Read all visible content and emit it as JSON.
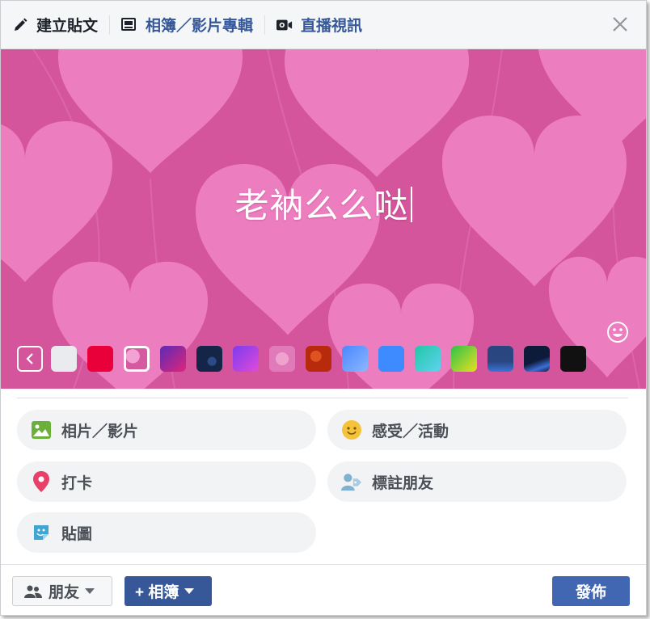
{
  "tabs": [
    {
      "label": "建立貼文",
      "icon": "pencil-icon",
      "active": true
    },
    {
      "label": "相簿／影片專輯",
      "icon": "album-icon",
      "active": false
    },
    {
      "label": "直播視訊",
      "icon": "video-camera-icon",
      "active": false
    }
  ],
  "composer": {
    "text": "老衲么么哒",
    "background": "pink-hearts",
    "swatches": [
      {
        "name": "white",
        "color": "#e9ebee"
      },
      {
        "name": "red",
        "color": "#e9003a"
      },
      {
        "name": "pink-hearts",
        "color": "#e37fbd",
        "selected": true
      },
      {
        "name": "purple-magenta-gradient",
        "color": "#9c2bb0"
      },
      {
        "name": "dark-navy-pattern",
        "color": "#1c2f5a"
      },
      {
        "name": "purple-violet-gradient",
        "color": "#c43ef0"
      },
      {
        "name": "light-pink-pattern",
        "color": "#e68cc4"
      },
      {
        "name": "red-orange-pattern",
        "color": "#c5300f"
      },
      {
        "name": "blue-sky",
        "color": "#5b9bff"
      },
      {
        "name": "blue",
        "color": "#3d8bff"
      },
      {
        "name": "teal-gradient",
        "color": "#3ccfc0"
      },
      {
        "name": "green-yellow-gradient",
        "color": "#7ad61a"
      },
      {
        "name": "dark-blue-pattern",
        "color": "#22396a"
      },
      {
        "name": "night-sky",
        "color": "#17234a"
      },
      {
        "name": "black",
        "color": "#111111"
      }
    ]
  },
  "actions": [
    {
      "label": "相片／影片",
      "icon": "photo-icon",
      "color": "#6bb03a"
    },
    {
      "label": "感受／活動",
      "icon": "smiley-icon",
      "color": "#f5c33b"
    },
    {
      "label": "打卡",
      "icon": "location-pin-icon",
      "color": "#e9406a"
    },
    {
      "label": "標註朋友",
      "icon": "tag-friend-icon",
      "color": "#7fb1d1"
    },
    {
      "label": "貼圖",
      "icon": "sticker-icon",
      "color": "#3fa6d4"
    }
  ],
  "footer": {
    "audience_label": "朋友",
    "album_label": "+ 相簿",
    "post_label": "發佈"
  }
}
